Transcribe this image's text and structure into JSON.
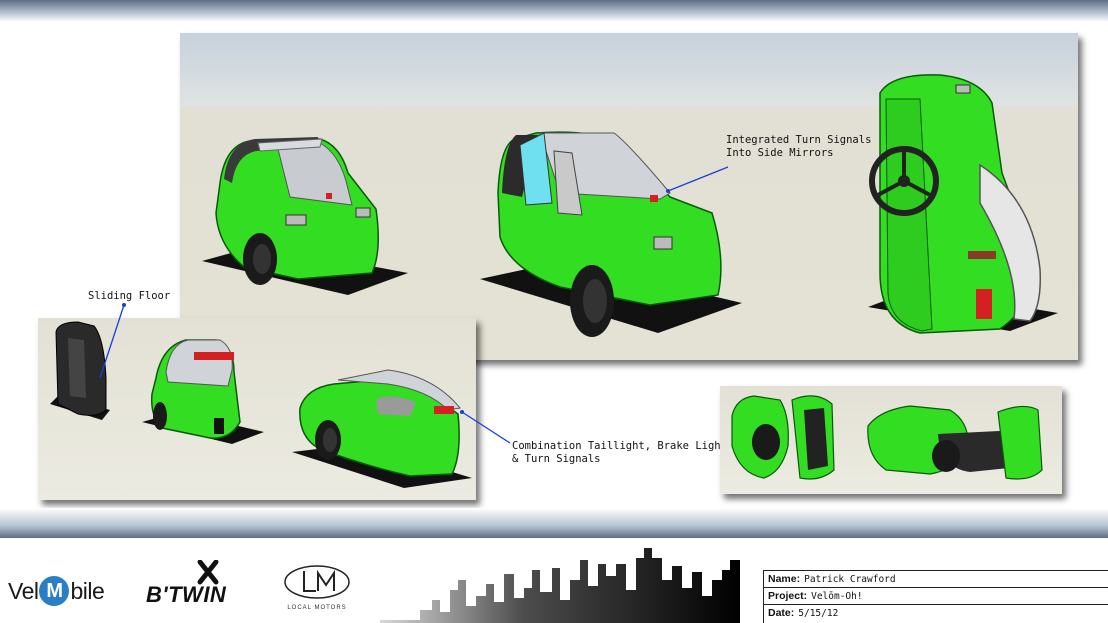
{
  "callouts": {
    "turn_signals_mirrors": [
      "Integrated Turn Signals",
      "Into Side Mirrors"
    ],
    "sliding_floor": "Sliding Floor",
    "taillight": [
      "Combination Taillight, Brake Light,",
      "& Turn Signals"
    ]
  },
  "footer": {
    "logos": {
      "velomobile_prefix": "Vel",
      "velomobile_circle": "M",
      "velomobile_suffix": "bile",
      "btwin": "B'TWIN",
      "local_motors": "LOCAL MOTORS"
    },
    "info": {
      "name_label": "Name:",
      "name_value": "Patrick Crawford",
      "project_label": "Project:",
      "project_value": "Velōm-Oh!",
      "date_label": "Date:",
      "date_value": "5/15/12"
    }
  },
  "colors": {
    "vehicle_green": "#33dd22",
    "accent_red": "#d42020",
    "callout_line": "#1a3fd6",
    "header_band": "#5d6f86"
  }
}
